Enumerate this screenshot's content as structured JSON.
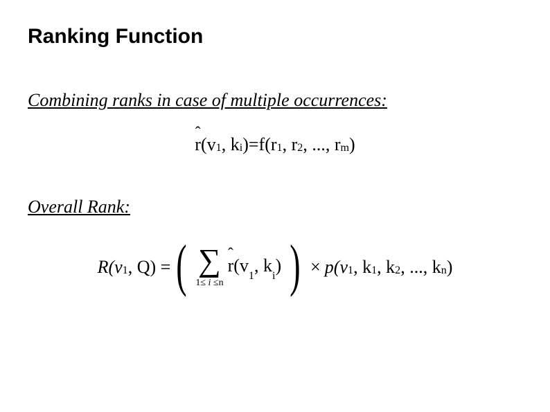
{
  "title": "Ranking Function",
  "sections": {
    "combining": {
      "label": "Combining ranks in case of multiple occurrences:",
      "formula": {
        "lhs_hat": "r",
        "lhs_hat_char": "ˆ",
        "lhs_open": "(v",
        "lhs_v_sub": "1",
        "lhs_mid": ", k",
        "lhs_k_sub": "i",
        "lhs_close": ")",
        "eq": " = ",
        "rhs_f": "f(r",
        "r1_sub": "1",
        "sep1": ", r",
        "r2_sub": "2",
        "sep2": ", ..., r",
        "rm_sub": "m",
        "rhs_close": ")"
      }
    },
    "overall": {
      "label": "Overall Rank:",
      "formula": {
        "lhs_R": "R(v",
        "lv_sub": "1",
        "lhs_mid": ", Q) = ",
        "sum_symbol": "∑",
        "sum_limit_pre": "1≤",
        "sum_limit_var": " i ",
        "sum_limit_post": "≤n",
        "body_hat": "r",
        "body_hat_char": "ˆ",
        "body_open": "(v",
        "bv_sub": "1",
        "body_mid": ", k",
        "bk_sub": "i",
        "body_close": ")",
        "times": "×",
        "p_pre": "p(v",
        "pv_sub": "1",
        "p_k1": ", k",
        "pk1_sub": "1",
        "p_k2": ", k",
        "pk2_sub": "2",
        "p_dots": ", ..., k",
        "pkn_sub": "n",
        "p_close": ")"
      }
    }
  }
}
